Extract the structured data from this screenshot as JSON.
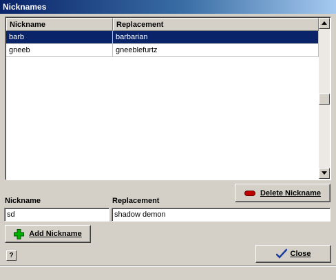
{
  "window": {
    "title": "Nicknames"
  },
  "table": {
    "columns": [
      "Nickname",
      "Replacement"
    ],
    "rows": [
      {
        "nickname": "barb",
        "replacement": "barbarian",
        "selected": true
      },
      {
        "nickname": "gneeb",
        "replacement": "gneeblefurtz",
        "selected": false
      }
    ]
  },
  "buttons": {
    "delete_label": "Delete Nickname",
    "add_label": "Add Nickname",
    "close_label": "Close",
    "help_label": "?"
  },
  "form": {
    "nickname_label": "Nickname",
    "replacement_label": "Replacement",
    "nickname_value": "sd",
    "replacement_value": "shadow demon"
  },
  "icons": {
    "delete": "minus-icon",
    "add": "plus-icon",
    "close": "checkmark-icon",
    "help": "question-icon"
  },
  "colors": {
    "selection": "#0a246a",
    "delete_icon": "#c00000",
    "add_icon": "#00b000",
    "close_icon": "#1a3c9c"
  }
}
